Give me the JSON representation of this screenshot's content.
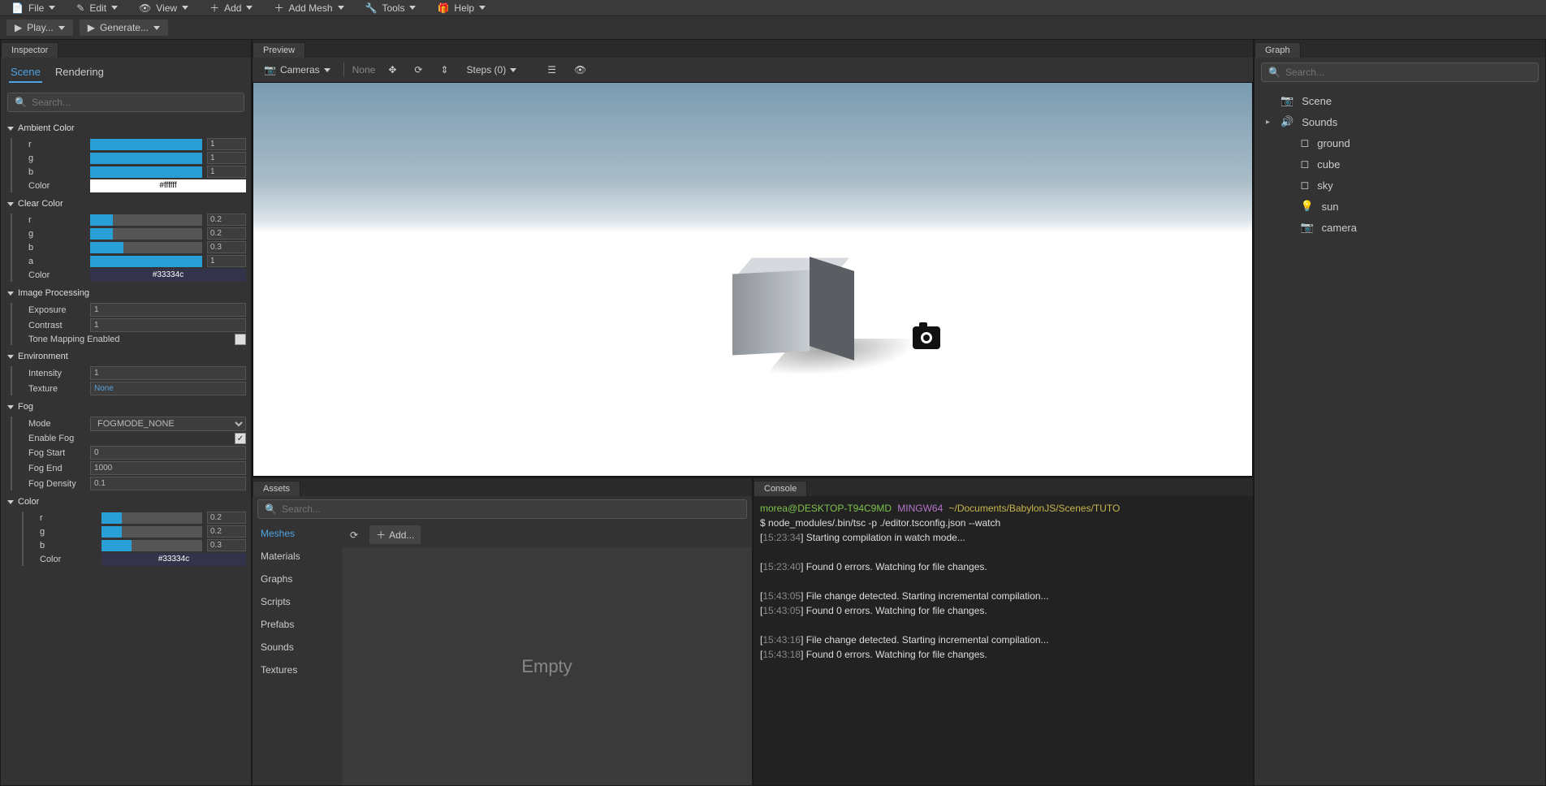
{
  "menubar": {
    "items": [
      {
        "label": "File",
        "icon": "file"
      },
      {
        "label": "Edit",
        "icon": "pencil"
      },
      {
        "label": "View",
        "icon": "eye"
      },
      {
        "label": "Add",
        "icon": "plus"
      },
      {
        "label": "Add Mesh",
        "icon": "plus"
      },
      {
        "label": "Tools",
        "icon": "wrench"
      },
      {
        "label": "Help",
        "icon": "gift"
      }
    ]
  },
  "toolbar": {
    "play": "Play...",
    "generate": "Generate..."
  },
  "inspector": {
    "tab": "Inspector",
    "subtabs": [
      "Scene",
      "Rendering"
    ],
    "search_placeholder": "Search...",
    "sections": {
      "ambient_color": {
        "title": "Ambient Color",
        "rows": [
          {
            "label": "r",
            "pct": 100,
            "val": "1"
          },
          {
            "label": "g",
            "pct": 100,
            "val": "1"
          },
          {
            "label": "b",
            "pct": 100,
            "val": "1"
          }
        ],
        "color": {
          "label": "Color",
          "hex": "#ffffff"
        }
      },
      "clear_color": {
        "title": "Clear Color",
        "rows": [
          {
            "label": "r",
            "pct": 20,
            "val": "0.2"
          },
          {
            "label": "g",
            "pct": 20,
            "val": "0.2"
          },
          {
            "label": "b",
            "pct": 30,
            "val": "0.3"
          },
          {
            "label": "a",
            "pct": 100,
            "val": "1"
          }
        ],
        "color": {
          "label": "Color",
          "hex": "#33334c"
        }
      },
      "image_processing": {
        "title": "Image Processing",
        "exposure_label": "Exposure",
        "exposure": "1",
        "contrast_label": "Contrast",
        "contrast": "1",
        "tone_label": "Tone Mapping Enabled",
        "tone": false
      },
      "environment": {
        "title": "Environment",
        "intensity_label": "Intensity",
        "intensity": "1",
        "texture_label": "Texture",
        "texture": "None"
      },
      "fog": {
        "title": "Fog",
        "mode_label": "Mode",
        "mode": "FOGMODE_NONE",
        "enable_label": "Enable Fog",
        "enable": true,
        "start_label": "Fog Start",
        "start": "0",
        "end_label": "Fog End",
        "end": "1000",
        "density_label": "Fog Density",
        "density": "0.1"
      },
      "fog_color": {
        "title": "Color",
        "rows": [
          {
            "label": "r",
            "pct": 20,
            "val": "0.2"
          },
          {
            "label": "g",
            "pct": 20,
            "val": "0.2"
          },
          {
            "label": "b",
            "pct": 30,
            "val": "0.3"
          }
        ],
        "color": {
          "label": "Color",
          "hex": "#33334c"
        }
      }
    }
  },
  "preview": {
    "tab": "Preview",
    "cameras": "Cameras",
    "none": "None",
    "steps": "Steps (0)"
  },
  "assets": {
    "tab": "Assets",
    "search_placeholder": "Search...",
    "categories": [
      "Meshes",
      "Materials",
      "Graphs",
      "Scripts",
      "Prefabs",
      "Sounds",
      "Textures"
    ],
    "add": "Add...",
    "empty": "Empty"
  },
  "console": {
    "tab": "Console",
    "prompt_user": "morea@DESKTOP-T94C9MD",
    "prompt_env": "MINGW64",
    "prompt_path": "~/Documents/BabylonJS/Scenes/TUTO",
    "cmd": "node_modules/.bin/tsc -p ./editor.tsconfig.json --watch",
    "lines": [
      {
        "ts": "15:23:34",
        "msg": "Starting compilation in watch mode..."
      },
      {
        "ts": "15:23:40",
        "msg": "Found 0 errors. Watching for file changes."
      },
      {
        "ts": "15:43:05",
        "msg": "File change detected. Starting incremental compilation..."
      },
      {
        "ts": "15:43:05",
        "msg": "Found 0 errors. Watching for file changes."
      },
      {
        "ts": "15:43:16",
        "msg": "File change detected. Starting incremental compilation..."
      },
      {
        "ts": "15:43:18",
        "msg": "Found 0 errors. Watching for file changes."
      }
    ]
  },
  "graph": {
    "tab": "Graph",
    "search_placeholder": "Search...",
    "items": [
      {
        "label": "Scene",
        "icon": "camera",
        "expand": ""
      },
      {
        "label": "Sounds",
        "icon": "speaker",
        "expand": "▸"
      },
      {
        "label": "ground",
        "icon": "box",
        "expand": ""
      },
      {
        "label": "cube",
        "icon": "box",
        "expand": ""
      },
      {
        "label": "sky",
        "icon": "box",
        "expand": ""
      },
      {
        "label": "sun",
        "icon": "bulb",
        "expand": ""
      },
      {
        "label": "camera",
        "icon": "camera",
        "expand": ""
      }
    ]
  }
}
